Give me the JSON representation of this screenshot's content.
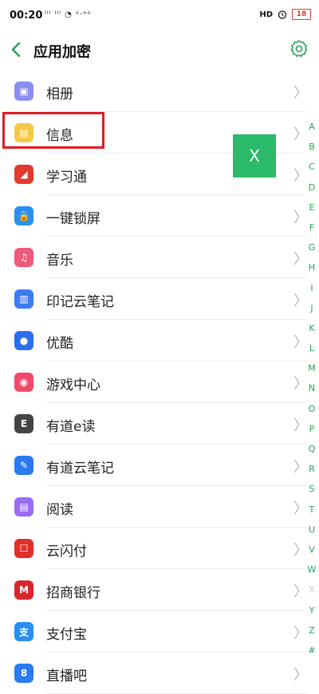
{
  "status_bar": {
    "time": "00:20",
    "left_indicators": "ᴵᴵˡ ᴵᴵˡ ◔ ᵒ·ᵒᵒ",
    "hd_label": "HD",
    "battery": "18"
  },
  "header": {
    "title": "应用加密"
  },
  "apps": [
    {
      "label": "相册",
      "color": "#8a8ef0"
    },
    {
      "label": "信息",
      "color": "#f4c94a"
    },
    {
      "label": "学习通",
      "color": "#e23a2c"
    },
    {
      "label": "一键锁屏",
      "color": "#2d8ef0"
    },
    {
      "label": "音乐",
      "color": "#ee5a7a"
    },
    {
      "label": "印记云笔记",
      "color": "#3d7cf0"
    },
    {
      "label": "优酷",
      "color": "#2d6ef0"
    },
    {
      "label": "游戏中心",
      "color": "#f04a6a"
    },
    {
      "label": "有道e读",
      "color": "#444444"
    },
    {
      "label": "有道云笔记",
      "color": "#2a7af0"
    },
    {
      "label": "阅读",
      "color": "#9a6cf0"
    },
    {
      "label": "云闪付",
      "color": "#e0302c"
    },
    {
      "label": "招商银行",
      "color": "#d9262c"
    },
    {
      "label": "支付宝",
      "color": "#2a8ef0"
    },
    {
      "label": "直播吧",
      "color": "#2a7af0"
    }
  ],
  "chevron": "〉",
  "overlay_button": "X",
  "alpha_index": [
    "A",
    "B",
    "C",
    "D",
    "E",
    "F",
    "G",
    "H",
    "I",
    "J",
    "K",
    "L",
    "M",
    "N",
    "O",
    "P",
    "Q",
    "R",
    "S",
    "T",
    "U",
    "V",
    "W",
    "X",
    "Y",
    "Z",
    "#"
  ],
  "colors": {
    "accent": "#2ba05a",
    "highlight": "#e11b22",
    "overlay_green": "#2bba6a"
  }
}
